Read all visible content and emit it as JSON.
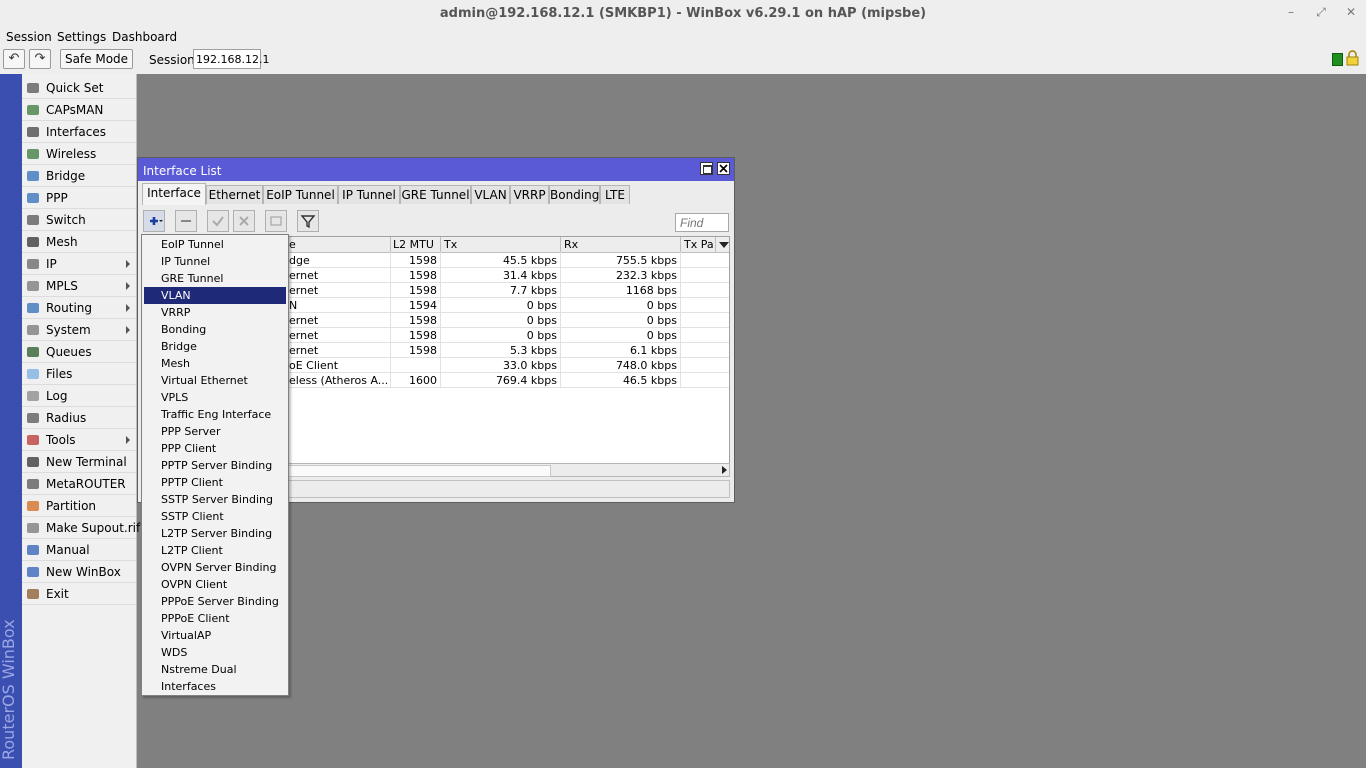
{
  "window": {
    "title": "admin@192.168.12.1 (SMKBP1) - WinBox v6.29.1 on hAP (mipsbe)",
    "controls": [
      "–",
      "⤢",
      "✕"
    ]
  },
  "menubar": [
    "Session",
    "Settings",
    "Dashboard"
  ],
  "toolbar": {
    "undo_icon": "↶",
    "redo_icon": "↷",
    "safe_mode": "Safe Mode",
    "session_label": "Session:",
    "session_value": "192.168.12.1"
  },
  "brand": "RouterOS WinBox",
  "sidebar": {
    "items": [
      {
        "label": "Quick Set",
        "icon": "wand-icon",
        "submenu": false
      },
      {
        "label": "CAPsMAN",
        "icon": "antenna-icon",
        "submenu": false
      },
      {
        "label": "Interfaces",
        "icon": "network-icon",
        "submenu": false
      },
      {
        "label": "Wireless",
        "icon": "antenna-icon",
        "submenu": false
      },
      {
        "label": "Bridge",
        "icon": "bridge-icon",
        "submenu": false
      },
      {
        "label": "PPP",
        "icon": "ppp-icon",
        "submenu": false
      },
      {
        "label": "Switch",
        "icon": "switch-icon",
        "submenu": false
      },
      {
        "label": "Mesh",
        "icon": "mesh-icon",
        "submenu": false
      },
      {
        "label": "IP",
        "icon": "ip-icon",
        "submenu": true
      },
      {
        "label": "MPLS",
        "icon": "mpls-icon",
        "submenu": true
      },
      {
        "label": "Routing",
        "icon": "routing-icon",
        "submenu": true
      },
      {
        "label": "System",
        "icon": "gear-icon",
        "submenu": true
      },
      {
        "label": "Queues",
        "icon": "queues-icon",
        "submenu": false
      },
      {
        "label": "Files",
        "icon": "folder-icon",
        "submenu": false
      },
      {
        "label": "Log",
        "icon": "log-icon",
        "submenu": false
      },
      {
        "label": "Radius",
        "icon": "radius-icon",
        "submenu": false
      },
      {
        "label": "Tools",
        "icon": "tools-icon",
        "submenu": true
      },
      {
        "label": "New Terminal",
        "icon": "terminal-icon",
        "submenu": false
      },
      {
        "label": "MetaROUTER",
        "icon": "metarouter-icon",
        "submenu": false
      },
      {
        "label": "Partition",
        "icon": "pie-icon",
        "submenu": false
      },
      {
        "label": "Make Supout.rif",
        "icon": "document-icon",
        "submenu": false
      },
      {
        "label": "Manual",
        "icon": "help-icon",
        "submenu": false
      },
      {
        "label": "New WinBox",
        "icon": "globe-icon",
        "submenu": false
      },
      {
        "label": "Exit",
        "icon": "exit-icon",
        "submenu": false
      }
    ]
  },
  "interface_window": {
    "title": "Interface List",
    "tabs": [
      "Interface",
      "Ethernet",
      "EoIP Tunnel",
      "IP Tunnel",
      "GRE Tunnel",
      "VLAN",
      "VRRP",
      "Bonding",
      "LTE"
    ],
    "find_placeholder": "Find",
    "columns": [
      "e",
      "L2 MTU",
      "Tx",
      "Rx",
      "Tx Pac"
    ],
    "rows": [
      {
        "type": "dge",
        "l2mtu": "1598",
        "tx": "45.5 kbps",
        "rx": "755.5 kbps"
      },
      {
        "type": "ernet",
        "l2mtu": "1598",
        "tx": "31.4 kbps",
        "rx": "232.3 kbps"
      },
      {
        "type": "ernet",
        "l2mtu": "1598",
        "tx": "7.7 kbps",
        "rx": "1168 bps"
      },
      {
        "type": "N",
        "l2mtu": "1594",
        "tx": "0 bps",
        "rx": "0 bps"
      },
      {
        "type": "ernet",
        "l2mtu": "1598",
        "tx": "0 bps",
        "rx": "0 bps"
      },
      {
        "type": "ernet",
        "l2mtu": "1598",
        "tx": "0 bps",
        "rx": "0 bps"
      },
      {
        "type": "ernet",
        "l2mtu": "1598",
        "tx": "5.3 kbps",
        "rx": "6.1 kbps"
      },
      {
        "type": "oE Client",
        "l2mtu": "",
        "tx": "33.0 kbps",
        "rx": "748.0 kbps"
      },
      {
        "type": "eless (Atheros A...",
        "l2mtu": "1600",
        "tx": "769.4 kbps",
        "rx": "46.5 kbps"
      }
    ]
  },
  "add_menu": {
    "selected": "VLAN",
    "items": [
      "EoIP Tunnel",
      "IP Tunnel",
      "GRE Tunnel",
      "VLAN",
      "VRRP",
      "Bonding",
      "Bridge",
      "Mesh",
      "Virtual Ethernet",
      "VPLS",
      "Traffic Eng Interface",
      "PPP Server",
      "PPP Client",
      "PPTP Server Binding",
      "PPTP Client",
      "SSTP Server Binding",
      "SSTP Client",
      "L2TP Server Binding",
      "L2TP Client",
      "OVPN Server Binding",
      "OVPN Client",
      "PPPoE Server Binding",
      "PPPoE Client",
      "VirtualAP",
      "WDS",
      "Nstreme Dual",
      "Interfaces"
    ]
  },
  "colors": {
    "brand_bar": "#3b4fb0",
    "window_title": "#5a5ad6",
    "selection": "#1e2a78",
    "desktop": "#808080"
  }
}
